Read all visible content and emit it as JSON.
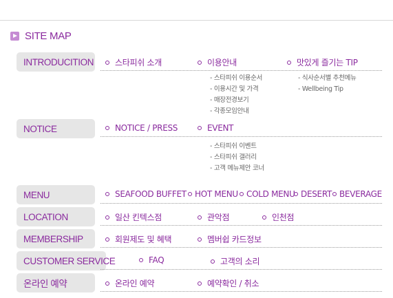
{
  "page": {
    "title": "SITE MAP"
  },
  "sections": {
    "intro": {
      "label": "INTRODUCITION",
      "items": [
        "스타피쉬 소개",
        "이용안내",
        "맛있게 즐기는 TIP"
      ],
      "sub_usage": [
        "스타피쉬 이용순서",
        "이용시간 및 가격",
        "매장전경보기",
        "각종모임안내"
      ],
      "sub_tip": [
        "식사순서별 추천메뉴",
        "Wellbeing Tip"
      ]
    },
    "notice": {
      "label": "NOTICE",
      "items": [
        "NOTICE / PRESS",
        "EVENT"
      ],
      "sub_event": [
        "스타피쉬 이벤트",
        "스타피쉬 갤러리",
        "고객 메뉴제안 코너"
      ]
    },
    "menu": {
      "label": "MENU",
      "items": [
        "SEAFOOD BUFFET",
        "HOT MENU",
        "COLD MENU",
        "DESERT",
        "BEVERAGE"
      ]
    },
    "location": {
      "label": "LOCATION",
      "items": [
        "일산 킨텍스점",
        "관악점",
        "인천점"
      ]
    },
    "membership": {
      "label": "MEMBERSHIP",
      "items": [
        "회원제도 및 혜택",
        "멤버쉽 카드정보"
      ]
    },
    "customer": {
      "label": "CUSTOMER SERVICE",
      "items": [
        "FAQ",
        "고객의 소리"
      ]
    },
    "reservation": {
      "label": "온라인 예약",
      "items": [
        "온라인 예약",
        "예약확인 / 취소"
      ]
    }
  }
}
